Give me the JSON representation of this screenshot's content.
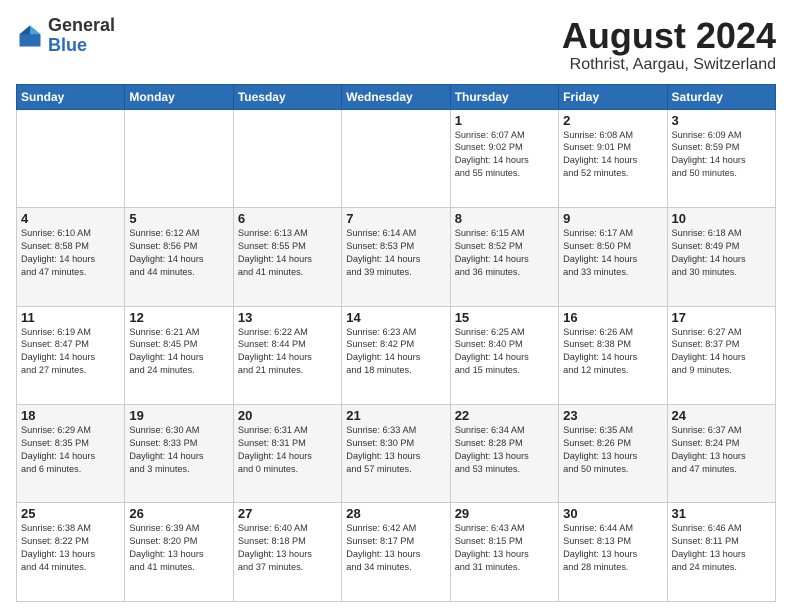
{
  "logo": {
    "general": "General",
    "blue": "Blue"
  },
  "title": "August 2024",
  "location": "Rothrist, Aargau, Switzerland",
  "days_of_week": [
    "Sunday",
    "Monday",
    "Tuesday",
    "Wednesday",
    "Thursday",
    "Friday",
    "Saturday"
  ],
  "weeks": [
    [
      {
        "day": "",
        "info": ""
      },
      {
        "day": "",
        "info": ""
      },
      {
        "day": "",
        "info": ""
      },
      {
        "day": "",
        "info": ""
      },
      {
        "day": "1",
        "info": "Sunrise: 6:07 AM\nSunset: 9:02 PM\nDaylight: 14 hours\nand 55 minutes."
      },
      {
        "day": "2",
        "info": "Sunrise: 6:08 AM\nSunset: 9:01 PM\nDaylight: 14 hours\nand 52 minutes."
      },
      {
        "day": "3",
        "info": "Sunrise: 6:09 AM\nSunset: 8:59 PM\nDaylight: 14 hours\nand 50 minutes."
      }
    ],
    [
      {
        "day": "4",
        "info": "Sunrise: 6:10 AM\nSunset: 8:58 PM\nDaylight: 14 hours\nand 47 minutes."
      },
      {
        "day": "5",
        "info": "Sunrise: 6:12 AM\nSunset: 8:56 PM\nDaylight: 14 hours\nand 44 minutes."
      },
      {
        "day": "6",
        "info": "Sunrise: 6:13 AM\nSunset: 8:55 PM\nDaylight: 14 hours\nand 41 minutes."
      },
      {
        "day": "7",
        "info": "Sunrise: 6:14 AM\nSunset: 8:53 PM\nDaylight: 14 hours\nand 39 minutes."
      },
      {
        "day": "8",
        "info": "Sunrise: 6:15 AM\nSunset: 8:52 PM\nDaylight: 14 hours\nand 36 minutes."
      },
      {
        "day": "9",
        "info": "Sunrise: 6:17 AM\nSunset: 8:50 PM\nDaylight: 14 hours\nand 33 minutes."
      },
      {
        "day": "10",
        "info": "Sunrise: 6:18 AM\nSunset: 8:49 PM\nDaylight: 14 hours\nand 30 minutes."
      }
    ],
    [
      {
        "day": "11",
        "info": "Sunrise: 6:19 AM\nSunset: 8:47 PM\nDaylight: 14 hours\nand 27 minutes."
      },
      {
        "day": "12",
        "info": "Sunrise: 6:21 AM\nSunset: 8:45 PM\nDaylight: 14 hours\nand 24 minutes."
      },
      {
        "day": "13",
        "info": "Sunrise: 6:22 AM\nSunset: 8:44 PM\nDaylight: 14 hours\nand 21 minutes."
      },
      {
        "day": "14",
        "info": "Sunrise: 6:23 AM\nSunset: 8:42 PM\nDaylight: 14 hours\nand 18 minutes."
      },
      {
        "day": "15",
        "info": "Sunrise: 6:25 AM\nSunset: 8:40 PM\nDaylight: 14 hours\nand 15 minutes."
      },
      {
        "day": "16",
        "info": "Sunrise: 6:26 AM\nSunset: 8:38 PM\nDaylight: 14 hours\nand 12 minutes."
      },
      {
        "day": "17",
        "info": "Sunrise: 6:27 AM\nSunset: 8:37 PM\nDaylight: 14 hours\nand 9 minutes."
      }
    ],
    [
      {
        "day": "18",
        "info": "Sunrise: 6:29 AM\nSunset: 8:35 PM\nDaylight: 14 hours\nand 6 minutes."
      },
      {
        "day": "19",
        "info": "Sunrise: 6:30 AM\nSunset: 8:33 PM\nDaylight: 14 hours\nand 3 minutes."
      },
      {
        "day": "20",
        "info": "Sunrise: 6:31 AM\nSunset: 8:31 PM\nDaylight: 14 hours\nand 0 minutes."
      },
      {
        "day": "21",
        "info": "Sunrise: 6:33 AM\nSunset: 8:30 PM\nDaylight: 13 hours\nand 57 minutes."
      },
      {
        "day": "22",
        "info": "Sunrise: 6:34 AM\nSunset: 8:28 PM\nDaylight: 13 hours\nand 53 minutes."
      },
      {
        "day": "23",
        "info": "Sunrise: 6:35 AM\nSunset: 8:26 PM\nDaylight: 13 hours\nand 50 minutes."
      },
      {
        "day": "24",
        "info": "Sunrise: 6:37 AM\nSunset: 8:24 PM\nDaylight: 13 hours\nand 47 minutes."
      }
    ],
    [
      {
        "day": "25",
        "info": "Sunrise: 6:38 AM\nSunset: 8:22 PM\nDaylight: 13 hours\nand 44 minutes."
      },
      {
        "day": "26",
        "info": "Sunrise: 6:39 AM\nSunset: 8:20 PM\nDaylight: 13 hours\nand 41 minutes."
      },
      {
        "day": "27",
        "info": "Sunrise: 6:40 AM\nSunset: 8:18 PM\nDaylight: 13 hours\nand 37 minutes."
      },
      {
        "day": "28",
        "info": "Sunrise: 6:42 AM\nSunset: 8:17 PM\nDaylight: 13 hours\nand 34 minutes."
      },
      {
        "day": "29",
        "info": "Sunrise: 6:43 AM\nSunset: 8:15 PM\nDaylight: 13 hours\nand 31 minutes."
      },
      {
        "day": "30",
        "info": "Sunrise: 6:44 AM\nSunset: 8:13 PM\nDaylight: 13 hours\nand 28 minutes."
      },
      {
        "day": "31",
        "info": "Sunrise: 6:46 AM\nSunset: 8:11 PM\nDaylight: 13 hours\nand 24 minutes."
      }
    ]
  ]
}
